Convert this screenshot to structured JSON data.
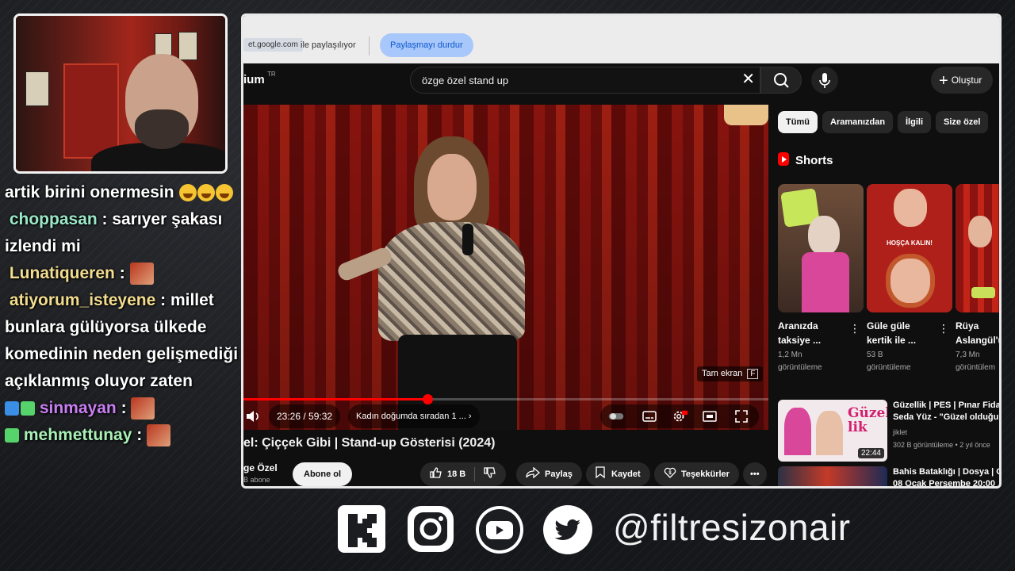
{
  "chat": [
    {
      "user": "",
      "text": "artik birini onermesin",
      "emojis": 3
    },
    {
      "user": "choppasan",
      "text": "sarıyer şakası izlendi mi"
    },
    {
      "user": "Lunatiqueren",
      "text": ""
    },
    {
      "user": "atiyorum_isteyene",
      "text": "millet bunlara gülüyorsa ülkede komedinin neden gelişmediği açıklanmış oluyor zaten"
    },
    {
      "user": "sinmayan",
      "text": ""
    },
    {
      "user": "mehmettunay",
      "text": ""
    }
  ],
  "share_bar": {
    "url": "et.google.com",
    "sharing_text": "ile paylaşılıyor",
    "stop_label": "Paylaşmayı durdur"
  },
  "youtube": {
    "logo_fragment": "ium",
    "logo_region": "TR",
    "search_value": "özge özel stand up",
    "create_label": "Oluştur",
    "player": {
      "time": "23:26 / 59:32",
      "chapter": "Kadın doğumda sıradan 1 ...",
      "fullscreen_tip": "Tam ekran",
      "fullscreen_key": "F",
      "progress": 0.35
    },
    "video_title": "el: Çiççek Gibi | Stand-up Gösterisi (2024)",
    "channel_name": "ge Özel",
    "channel_subs": "B abone",
    "subscribe_label": "Abone ol",
    "actions": {
      "likes": "18 B",
      "share": "Paylaş",
      "save": "Kaydet",
      "thanks": "Teşekkürler"
    },
    "chips": [
      "Tümü",
      "Aramanızdan",
      "İlgili",
      "Size özel"
    ],
    "shorts_title": "Shorts",
    "shorts": [
      {
        "title1": "Aranızda",
        "title2": "taksiye ...",
        "views1": "1,2 Mn",
        "views2": "görüntüleme"
      },
      {
        "title1": "Güle güle",
        "title2": "kertik ile ...",
        "views1": "53 B",
        "views2": "görüntüleme",
        "overlay": "HOŞÇA KALIN!"
      },
      {
        "title1": "Rüya",
        "title2": "Aslangül'ü",
        "views1": "7,3 Mn",
        "views2": "görüntülem"
      }
    ],
    "videos": [
      {
        "title1": "Güzellik | PES | Pınar Fidan",
        "title2": "Seda Yüz - \"Güzel olduğum",
        "channel": "jiklet",
        "meta": "302 B görüntüleme • 2 yıl önce",
        "duration": "22:44",
        "thumb_text": "Güzel lik"
      },
      {
        "title1": "Bahis Bataklığı | Dosya | Ca",
        "title2": "08 Ocak Perşembe 20:00",
        "channel": "",
        "meta": "",
        "duration": ""
      }
    ]
  },
  "social_handle": "@filtresizonair",
  "colors": {
    "accent_red": "#ff0000",
    "chip_bg": "#272727",
    "share_btn": "#a8c7fa"
  }
}
